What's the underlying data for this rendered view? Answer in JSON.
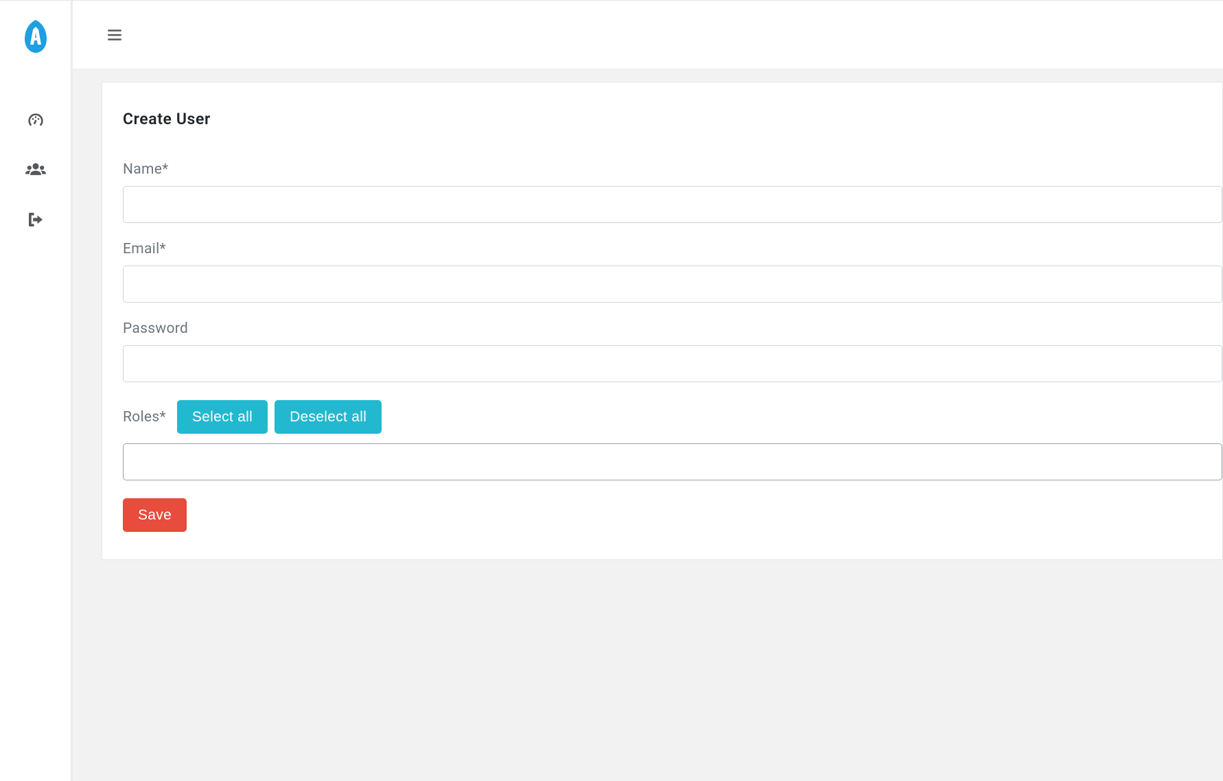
{
  "page": {
    "title": "Create User"
  },
  "form": {
    "name": {
      "label": "Name*",
      "value": ""
    },
    "email": {
      "label": "Email*",
      "value": ""
    },
    "password": {
      "label": "Password",
      "value": ""
    },
    "roles": {
      "label": "Roles*",
      "select_all_label": "Select all",
      "deselect_all_label": "Deselect all"
    },
    "save_label": "Save"
  },
  "sidebar": {
    "items": [
      {
        "name": "dashboard"
      },
      {
        "name": "users"
      },
      {
        "name": "logout"
      }
    ]
  }
}
